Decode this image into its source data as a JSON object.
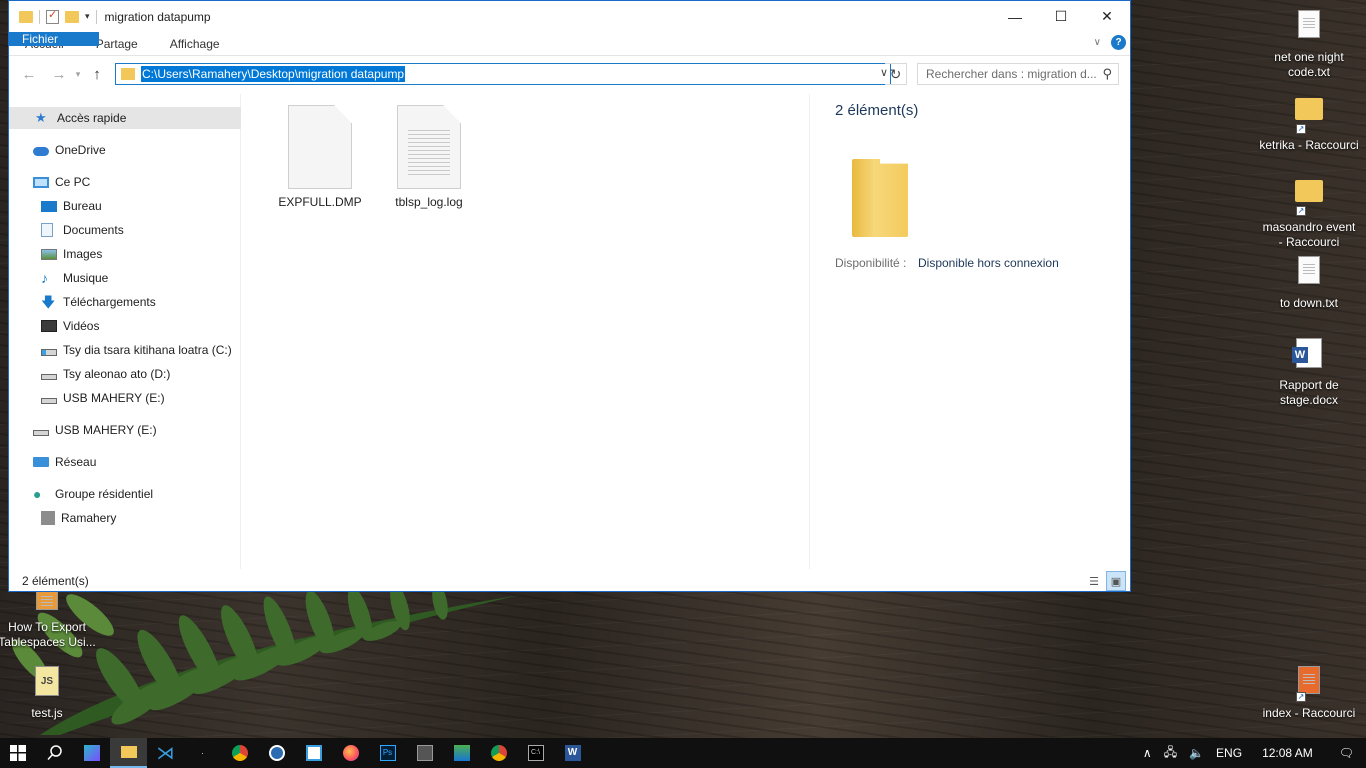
{
  "window": {
    "title": "migration datapump",
    "controls": {
      "minimize": "—",
      "maximize": "☐",
      "close": "✕"
    }
  },
  "ribbon": {
    "tabs": [
      "Fichier",
      "Accueil",
      "Partage",
      "Affichage"
    ],
    "help": "?"
  },
  "navbar": {
    "back": "←",
    "forward": "→",
    "up": "↑",
    "address": "C:\\Users\\Ramahery\\Desktop\\migration datapump",
    "refresh": "↻",
    "search_placeholder": "Rechercher dans : migration d...",
    "search_icon": "⚲"
  },
  "sidebar": {
    "items": [
      {
        "label": "Accès rapide",
        "icon": "star-icon"
      },
      {
        "label": "OneDrive",
        "icon": "cloud-icon"
      },
      {
        "label": "Ce PC",
        "icon": "computer-icon"
      },
      {
        "label": "Bureau",
        "icon": "desktop-icon"
      },
      {
        "label": "Documents",
        "icon": "documents-icon"
      },
      {
        "label": "Images",
        "icon": "images-icon"
      },
      {
        "label": "Musique",
        "icon": "music-icon"
      },
      {
        "label": "Téléchargements",
        "icon": "download-icon"
      },
      {
        "label": "Vidéos",
        "icon": "video-icon"
      },
      {
        "label": "Tsy dia tsara kitihana loatra (C:)",
        "icon": "drive-c-icon"
      },
      {
        "label": "Tsy aleonao ato (D:)",
        "icon": "drive-icon"
      },
      {
        "label": "USB MAHERY (E:)",
        "icon": "usb-drive-icon"
      },
      {
        "label": "USB MAHERY (E:)",
        "icon": "usb-drive-icon"
      },
      {
        "label": "Réseau",
        "icon": "network-icon"
      },
      {
        "label": "Groupe résidentiel",
        "icon": "homegroup-icon"
      },
      {
        "label": "Ramahery",
        "icon": "user-icon"
      }
    ]
  },
  "files": [
    {
      "name": "EXPFULL.DMP",
      "icon": "blank-file-icon"
    },
    {
      "name": "tblsp_log.log",
      "icon": "text-file-icon"
    }
  ],
  "details": {
    "count": "2 élément(s)",
    "availability_label": "Disponibilité :",
    "availability_value": "Disponible hors connexion"
  },
  "status": {
    "count": "2 élément(s)"
  },
  "desktop": {
    "icons": [
      {
        "label": "net one night code.txt",
        "icon": "text-file-icon"
      },
      {
        "label": "ketrika - Raccourci",
        "icon": "folder-shortcut-icon"
      },
      {
        "label": "masoandro event - Raccourci",
        "icon": "folder-shortcut-icon"
      },
      {
        "label": "to down.txt",
        "icon": "text-file-icon"
      },
      {
        "label": "Rapport de stage.docx",
        "icon": "word-file-icon"
      },
      {
        "label": "How To Export Tablespaces Usi...",
        "icon": "pdf-file-icon"
      },
      {
        "label": "test.js",
        "icon": "js-file-icon"
      },
      {
        "label": "index - Raccourci",
        "icon": "html-shortcut-icon"
      }
    ],
    "word_letter": "W",
    "js_letter": "JS"
  },
  "taskbar": {
    "lang": "ENG",
    "time": "12:08 AM",
    "apps": [
      "start-icon",
      "search-icon",
      "task-view-icon",
      "file-explorer-icon",
      "vscode-icon",
      "blank-app-icon",
      "chrome-icon",
      "kodi-icon",
      "libreoffice-icon",
      "firefox-icon",
      "photoshop-icon",
      "sqlplus-icon",
      "app-icon",
      "chrome-icon",
      "cmd-icon",
      "word-icon"
    ]
  },
  "colors": {
    "accent": "#1979ca",
    "selection": "#0078d7",
    "folder": "#f2c85b"
  }
}
